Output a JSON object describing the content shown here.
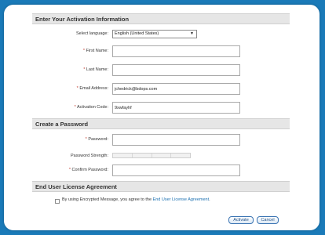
{
  "sections": {
    "activation": "Enter Your Activation Information",
    "password": "Create a Password",
    "eula": "End User License Agreement"
  },
  "fields": {
    "language": {
      "label": "Select language:",
      "value": "English (United States)"
    },
    "first_name": {
      "label": "First Name:",
      "value": ""
    },
    "last_name": {
      "label": "Last Name:",
      "value": ""
    },
    "email": {
      "label": "Email Address:",
      "value": "jchedrick@bdops.com"
    },
    "activation_code": {
      "label": "Activation Code:",
      "value": "9xwfayhf"
    },
    "password": {
      "label": "Password:",
      "value": ""
    },
    "strength": {
      "label": "Password Strength:"
    },
    "confirm_password": {
      "label": "Confirm Password:",
      "value": ""
    }
  },
  "required_marker": "*",
  "eula": {
    "agree_text": "By using Encrypted Message, you agree to the",
    "link_text": "End User License Agreement",
    "end": "."
  },
  "buttons": {
    "activate": "Activate",
    "cancel": "Cancel"
  }
}
